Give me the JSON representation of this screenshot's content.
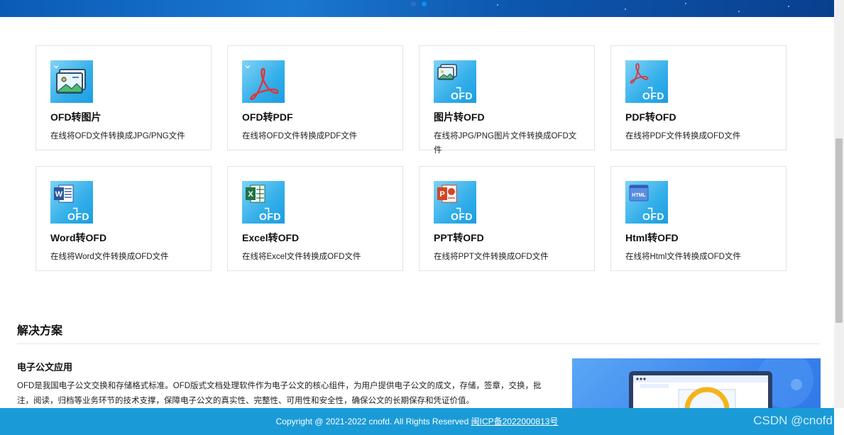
{
  "converters": [
    {
      "title": "OFD转图片",
      "desc": "在线将OFD文件转换成JPG/PNG文件",
      "icon": "image-icon"
    },
    {
      "title": "OFD转PDF",
      "desc": "在线将OFD文件转换成PDF文件",
      "icon": "pdf-icon"
    },
    {
      "title": "图片转OFD",
      "desc": "在线将JPG/PNG图片文件转换成OFD文件",
      "icon": "image-to-ofd-icon",
      "badge": "OFD"
    },
    {
      "title": "PDF转OFD",
      "desc": "在线将PDF文件转换成OFD文件",
      "icon": "pdf-to-ofd-icon",
      "badge": "OFD"
    },
    {
      "title": "Word转OFD",
      "desc": "在线将Word文件转换成OFD文件",
      "icon": "word-to-ofd-icon",
      "badge": "OFD"
    },
    {
      "title": "Excel转OFD",
      "desc": "在线将Excel文件转换成OFD文件",
      "icon": "excel-to-ofd-icon",
      "badge": "OFD"
    },
    {
      "title": "PPT转OFD",
      "desc": "在线将PPT文件转换成OFD文件",
      "icon": "ppt-to-ofd-icon",
      "badge": "OFD"
    },
    {
      "title": "Html转OFD",
      "desc": "在线将Html文件转换成OFD文件",
      "icon": "html-to-ofd-icon",
      "badge": "OFD"
    }
  ],
  "solutions": {
    "heading": "解决方案",
    "item_title": "电子公文应用",
    "item_text": "OFD是我国电子公文交换和存储格式标准。OFD版式文档处理软件作为电子公文的核心组件，为用户提供电子公文的成文，存储，签章，交换，批注，阅读，归档等业务环节的技术支撑，保障电子公文的真实性、完整性、可用性和安全性，确保公文的长期保存和凭证价值。"
  },
  "footer": {
    "copyright": "Copyright @ 2021-2022 cnofd. All Rights Reserved",
    "icp": "闽ICP备2022000813号"
  },
  "watermark": "CSDN @cnofd",
  "colors": {
    "footer_bg": "#1a9bd7",
    "icon_gradient_start": "#7fd3f7",
    "icon_gradient_end": "#1c9ee3",
    "pdf_red": "#e0343a",
    "banner_blue": "#0a5bb5"
  }
}
